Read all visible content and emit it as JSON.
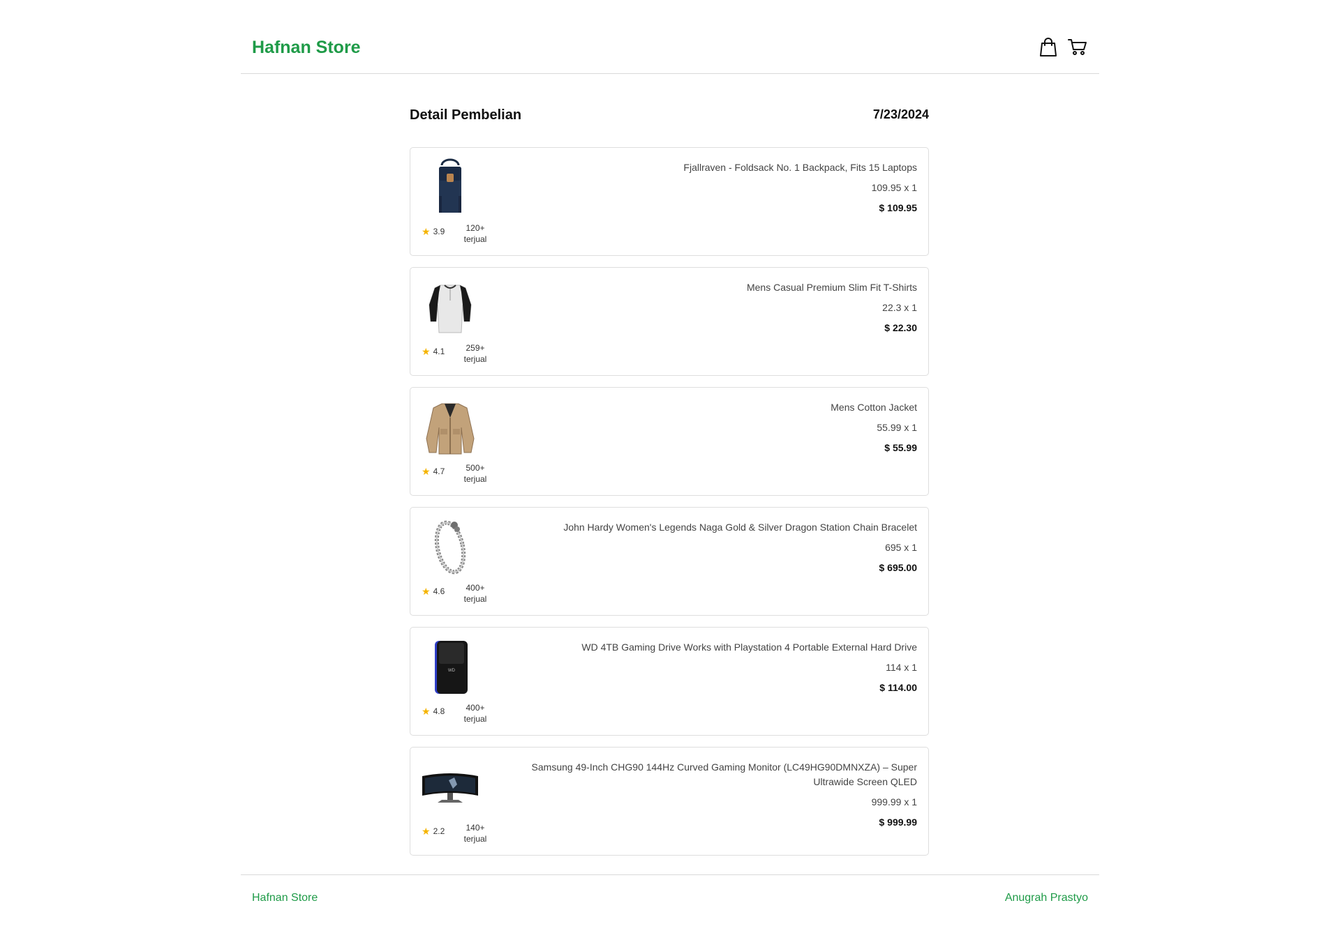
{
  "header": {
    "brand": "Hafnan Store",
    "icons": [
      "shopping-bag-icon",
      "cart-icon"
    ]
  },
  "detail": {
    "title": "Detail Pembelian",
    "date": "7/23/2024"
  },
  "items": [
    {
      "name": "Fjallraven - Foldsack No. 1 Backpack, Fits 15 Laptops",
      "qty": "109.95 x 1",
      "total": "$ 109.95",
      "rating": "3.9",
      "sold_count": "120+",
      "sold_label": "terjual",
      "image": "backpack"
    },
    {
      "name": "Mens Casual Premium Slim Fit T-Shirts",
      "qty": "22.3 x 1",
      "total": "$ 22.30",
      "rating": "4.1",
      "sold_count": "259+",
      "sold_label": "terjual",
      "image": "tshirt"
    },
    {
      "name": "Mens Cotton Jacket",
      "qty": "55.99 x 1",
      "total": "$ 55.99",
      "rating": "4.7",
      "sold_count": "500+",
      "sold_label": "terjual",
      "image": "jacket"
    },
    {
      "name": "John Hardy Women's Legends Naga Gold & Silver Dragon Station Chain Bracelet",
      "qty": "695 x 1",
      "total": "$ 695.00",
      "rating": "4.6",
      "sold_count": "400+",
      "sold_label": "terjual",
      "image": "bracelet"
    },
    {
      "name": "WD 4TB Gaming Drive Works with Playstation 4 Portable External Hard Drive",
      "qty": "114 x 1",
      "total": "$ 114.00",
      "rating": "4.8",
      "sold_count": "400+",
      "sold_label": "terjual",
      "image": "hard-drive"
    },
    {
      "name": "Samsung 49-Inch CHG90 144Hz Curved Gaming Monitor (LC49HG90DMNXZA) – Super Ultrawide Screen QLED",
      "qty": "999.99 x 1",
      "total": "$ 999.99",
      "rating": "2.2",
      "sold_count": "140+",
      "sold_label": "terjual",
      "image": "monitor"
    }
  ],
  "footer": {
    "left": "Hafnan Store",
    "right": "Anugrah Prastyo"
  },
  "colors": {
    "brand_green": "#1f9b48",
    "star_yellow": "#f5b400",
    "border": "#dedede"
  }
}
